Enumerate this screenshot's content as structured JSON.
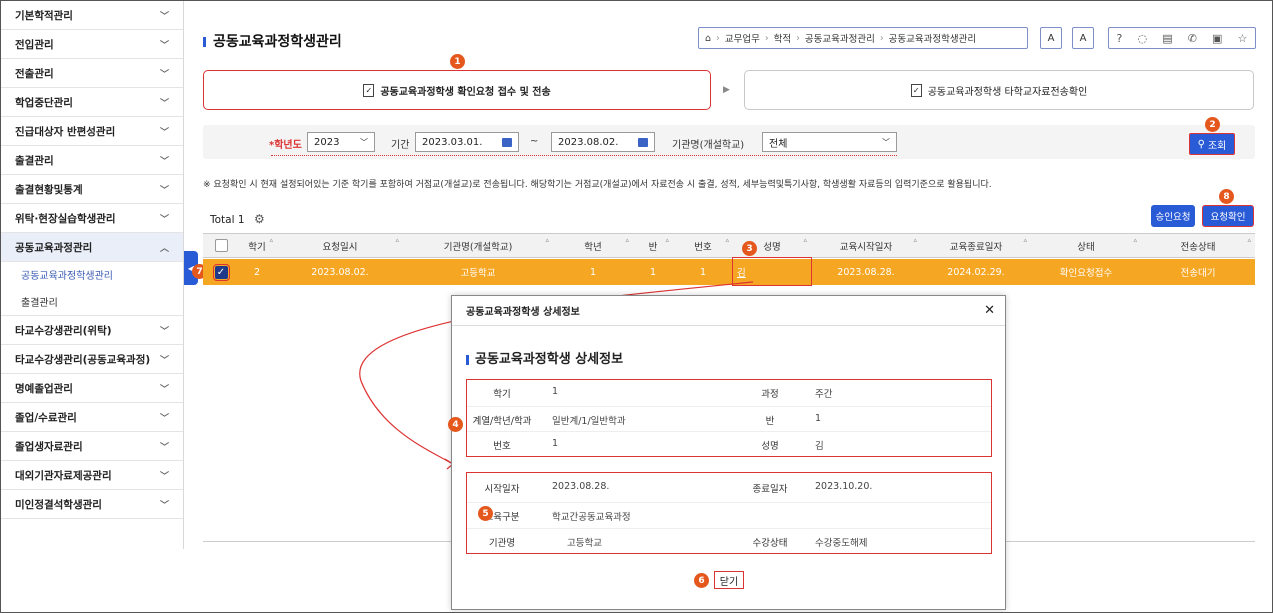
{
  "sidebar": {
    "items": [
      {
        "label": "기본학적관리"
      },
      {
        "label": "전입관리"
      },
      {
        "label": "전출관리"
      },
      {
        "label": "학업중단관리"
      },
      {
        "label": "진급대상자 반편성관리"
      },
      {
        "label": "출결관리"
      },
      {
        "label": "출결현황및통계"
      },
      {
        "label": "위탁·현장실습학생관리"
      },
      {
        "label": "공동교육과정관리"
      }
    ],
    "sub": [
      "공동교육과정학생관리",
      "출결관리"
    ],
    "items2": [
      {
        "label": "타교수강생관리(위탁)"
      },
      {
        "label": "타교수강생관리(공동교육과정)"
      },
      {
        "label": "명예졸업관리"
      },
      {
        "label": "졸업/수료관리"
      },
      {
        "label": "졸업생자료관리"
      },
      {
        "label": "대외기관자료제공관리"
      },
      {
        "label": "미인정결석학생관리"
      }
    ]
  },
  "header": {
    "title": "공동교육과정학생관리",
    "breadcrumb": [
      "교무업무",
      "학적",
      "공동교육과정관리",
      "공동교육과정학생관리"
    ],
    "font_btn_a1": "A",
    "font_btn_a2": "A"
  },
  "steps": {
    "step1": "공동교육과정학생 확인요청 접수 및 전송",
    "step2": "공동교육과정학생 타학교자료전송확인"
  },
  "filter": {
    "year_label": "*학년도",
    "year_value": "2023",
    "period_label": "기간",
    "from": "2023.03.01.",
    "tilde": "~",
    "to": "2023.08.02.",
    "org_label": "기관명(개설학교)",
    "org_value": "전체",
    "search_btn": "조회"
  },
  "notice": "※ 요청확인 시 현재 설정되어있는 기준 학기를 포함하여 거점교(개설교)로 전송됩니다. 해당학기는 거점교(개설교)에서 자료전송 시 출결, 성적, 세부능력및특기사항, 학생생활 자료등의 입력기준으로 활용됩니다.",
  "list": {
    "total_label": "Total",
    "total": "1",
    "approve_btn": "승인요청",
    "request_btn": "요청확인",
    "columns": [
      "학기",
      "요청일시",
      "기관명(개설학교)",
      "학년",
      "반",
      "번호",
      "성명",
      "교육시작일자",
      "교육종료일자",
      "상태",
      "전송상태"
    ],
    "row": [
      "2",
      "2023.08.02.",
      "고등학교",
      "1",
      "1",
      "1",
      "김",
      "2023.08.28.",
      "2024.02.29.",
      "확인요청접수",
      "전송대기"
    ]
  },
  "modal": {
    "header": "공동교육과정학생 상세정보",
    "title": "공동교육과정학생 상세정보",
    "semester_label": "학기",
    "semester": "1",
    "course_label": "과정",
    "course": "주간",
    "dept_label": "계열/학년/학과",
    "dept": "일반계/1/일반학과",
    "class_label": "반",
    "class": "1",
    "num_label": "번호",
    "num": "1",
    "name_label": "성명",
    "name": "김",
    "start_label": "시작일자",
    "start": "2023.08.28.",
    "end_label": "종료일자",
    "end": "2023.10.20.",
    "edu_label": "교육구분",
    "edu": "학교간공동교육과정",
    "org_label": "기관명",
    "org": "고등학교",
    "status_label": "수강상태",
    "status": "수강중도해제",
    "close_btn": "닫기"
  },
  "badges": [
    "1",
    "2",
    "3",
    "4",
    "5",
    "6",
    "7",
    "8"
  ],
  "colors": {
    "accent": "#2a5bd7",
    "highlight_row": "#f5a623",
    "annotation": "#e4581e",
    "outline": "#dd3333"
  }
}
